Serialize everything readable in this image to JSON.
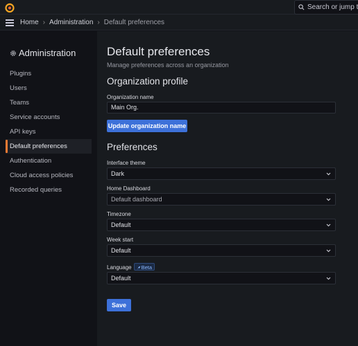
{
  "topbar": {
    "search_placeholder": "Search or jump to..."
  },
  "breadcrumb": {
    "home": "Home",
    "administration": "Administration",
    "current": "Default preferences"
  },
  "sidebar": {
    "title": "Administration",
    "items": [
      {
        "label": "Plugins"
      },
      {
        "label": "Users"
      },
      {
        "label": "Teams"
      },
      {
        "label": "Service accounts"
      },
      {
        "label": "API keys"
      },
      {
        "label": "Default preferences"
      },
      {
        "label": "Authentication"
      },
      {
        "label": "Cloud access policies"
      },
      {
        "label": "Recorded queries"
      }
    ],
    "active_index": 5
  },
  "main": {
    "title": "Default preferences",
    "subtitle": "Manage preferences across an organization",
    "org_profile": {
      "heading": "Organization profile",
      "name_label": "Organization name",
      "name_value": "Main Org.",
      "update_button": "Update organization name"
    },
    "preferences": {
      "heading": "Preferences",
      "theme_label": "Interface theme",
      "theme_value": "Dark",
      "home_label": "Home Dashboard",
      "home_value": "Default dashboard",
      "timezone_label": "Timezone",
      "timezone_value": "Default",
      "week_label": "Week start",
      "week_value": "Default",
      "language_label": "Language",
      "language_badge": "Beta",
      "language_value": "Default",
      "save_button": "Save"
    }
  },
  "colors": {
    "accent": "#3d71d9",
    "active_marker": "#f57a33",
    "background": "#111217",
    "panel": "#181b1f"
  },
  "icons": [
    "grafana-logo-icon",
    "search-icon",
    "menu-icon",
    "gear-icon",
    "chevron-down-icon",
    "rocket-icon"
  ]
}
